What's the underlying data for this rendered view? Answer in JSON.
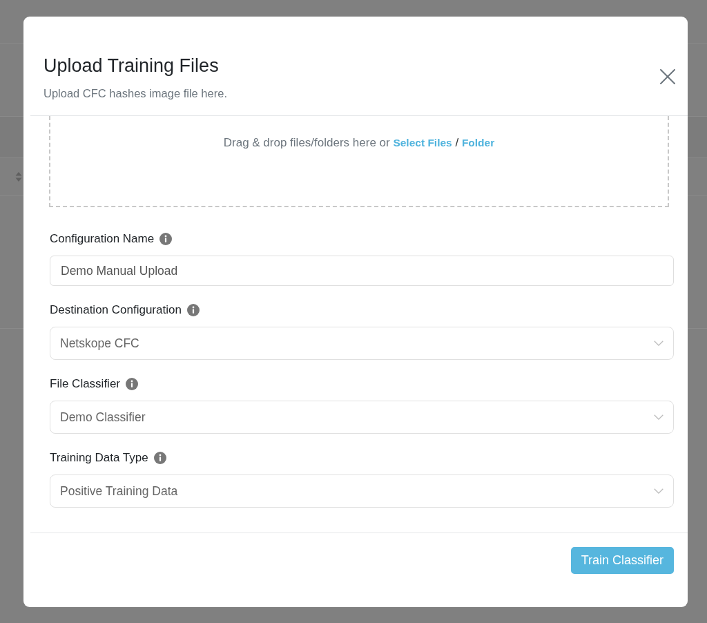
{
  "dialog": {
    "title": "Upload Training Files",
    "subtitle": "Upload CFC hashes image file here."
  },
  "dropzone": {
    "prompt": "Drag & drop files/folders here or",
    "links": [
      {
        "label": "Select Files"
      },
      {
        "label": "Folder"
      }
    ],
    "separator": "/"
  },
  "fields": [
    {
      "kind": "input",
      "label": "Configuration Name",
      "value": "Demo Manual Upload"
    },
    {
      "kind": "select",
      "label": "Destination Configuration",
      "value": "Netskope CFC"
    },
    {
      "kind": "select",
      "label": "File Classifier",
      "value": "Demo Classifier"
    },
    {
      "kind": "select",
      "label": "Training Data Type",
      "value": "Positive Training Data"
    }
  ],
  "footer": {
    "primary_button": "Train Classifier"
  }
}
